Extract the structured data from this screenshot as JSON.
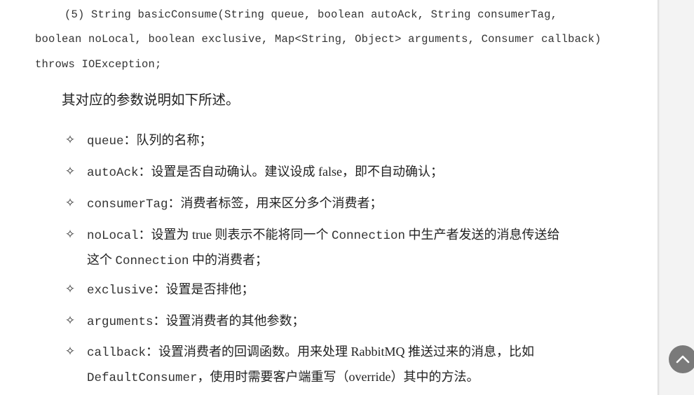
{
  "signature": {
    "line1": "(5) String basicConsume(String queue, boolean autoAck, String consumerTag,",
    "line2": "boolean noLocal, boolean exclusive, Map<String, Object> arguments, Consumer callback)",
    "line3": "throws IOException;"
  },
  "intro": "其对应的参数说明如下所述。",
  "bullet_glyph": "✧",
  "params": [
    {
      "name": "queue",
      "desc": "：队列的名称；"
    },
    {
      "name": "autoAck",
      "desc": "：设置是否自动确认。建议设成 false，即不自动确认；"
    },
    {
      "name": "consumerTag",
      "desc": "：消费者标签，用来区分多个消费者；"
    },
    {
      "name": "noLocal",
      "desc_a": "：设置为 true 则表示不能将同一个 ",
      "code_a": "Connection",
      "desc_b": " 中生产者发送的消息传送给",
      "desc_c": "这个 ",
      "code_b": "Connection",
      "desc_d": " 中的消费者；"
    },
    {
      "name": "exclusive",
      "desc": "：设置是否排他；"
    },
    {
      "name": "arguments",
      "desc": "：设置消费者的其他参数；"
    },
    {
      "name": "callback",
      "desc_a": "：设置消费者的回调函数。用来处理 RabbitMQ 推送过来的消息，比如",
      "code_a": "DefaultConsumer",
      "desc_b": "，使用时需要客户端重写（override）其中的方法。"
    }
  ],
  "scroll_top_icon": "chevron-up-icon",
  "colors": {
    "page": "#ffffff",
    "viewer_bg": "#f3f3f3",
    "scroll_button": "#7a7a7a"
  }
}
